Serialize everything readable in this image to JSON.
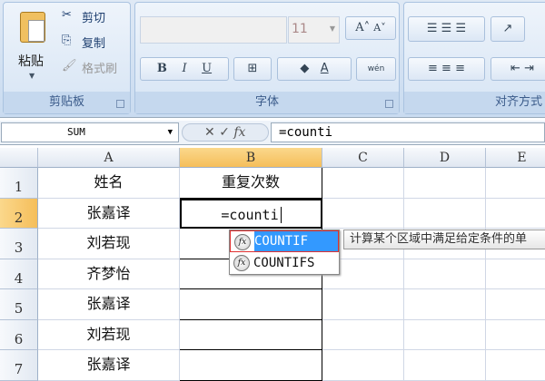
{
  "ribbon": {
    "clipboard": {
      "paste": "粘贴",
      "cut": "剪切",
      "copy": "复制",
      "format_painter": "格式刷",
      "label": "剪贴板"
    },
    "font": {
      "font_name": "",
      "font_size": "11",
      "bold": "B",
      "italic": "I",
      "underline": "U",
      "label": "字体",
      "phonetic": "wén"
    },
    "alignment": {
      "label": "对齐方式"
    }
  },
  "formula_bar": {
    "name_box": "SUM",
    "formula": "=counti",
    "cancel": "✕",
    "enter": "✓",
    "fx": "fx"
  },
  "columns": [
    "A",
    "B",
    "C",
    "D",
    "E"
  ],
  "rows": [
    {
      "num": "1",
      "a": "姓名",
      "b": "重复次数"
    },
    {
      "num": "2",
      "a": "张嘉译",
      "b": "=counti"
    },
    {
      "num": "3",
      "a": "刘若现",
      "b": ""
    },
    {
      "num": "4",
      "a": "齐梦怡",
      "b": ""
    },
    {
      "num": "5",
      "a": "张嘉译",
      "b": ""
    },
    {
      "num": "6",
      "a": "刘若现",
      "b": ""
    },
    {
      "num": "7",
      "a": "张嘉译",
      "b": ""
    }
  ],
  "autocomplete": {
    "items": [
      "COUNTIF",
      "COUNTIFS"
    ],
    "selected": "COUNTIF",
    "tooltip": "计算某个区域中满足给定条件的单"
  },
  "colors": {
    "selected_header": "#f5be5a",
    "highlight": "#3399ff",
    "ribbon": "#d6e4f4"
  }
}
